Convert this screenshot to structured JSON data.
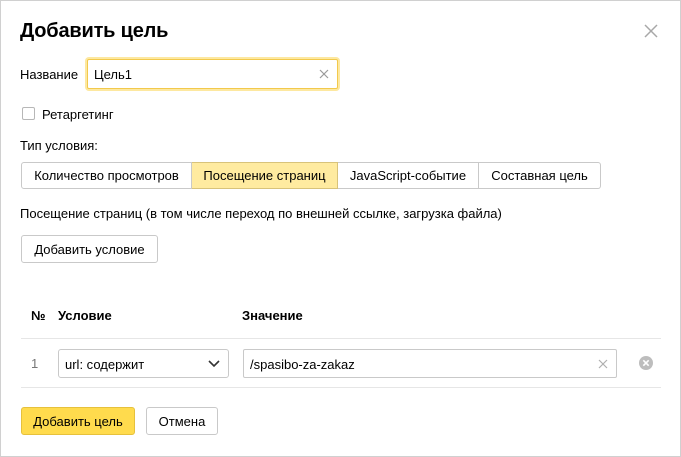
{
  "dialog": {
    "title": "Добавить цель"
  },
  "name_field": {
    "label": "Название",
    "value": "Цель1"
  },
  "retargeting": {
    "label": "Ретаргетинг",
    "checked": false
  },
  "condition_type": {
    "label": "Тип условия:",
    "options": [
      "Количество просмотров",
      "Посещение страниц",
      "JavaScript-событие",
      "Составная цель"
    ],
    "selected": "Посещение страниц"
  },
  "description": "Посещение страниц (в том числе переход по внешней ссылке, загрузка файла)",
  "add_condition_label": "Добавить условие",
  "table": {
    "headers": {
      "num": "№",
      "condition": "Условие",
      "value": "Значение"
    },
    "rows": [
      {
        "num": "1",
        "condition": "url: содержит",
        "value": "/spasibo-za-zakaz"
      }
    ]
  },
  "footer": {
    "primary_label": "Добавить цель",
    "cancel_label": "Отмена"
  },
  "colors": {
    "accent": "#ffdb4d",
    "active_segment": "#ffeba0",
    "focus_ring": "#fde8a0"
  }
}
